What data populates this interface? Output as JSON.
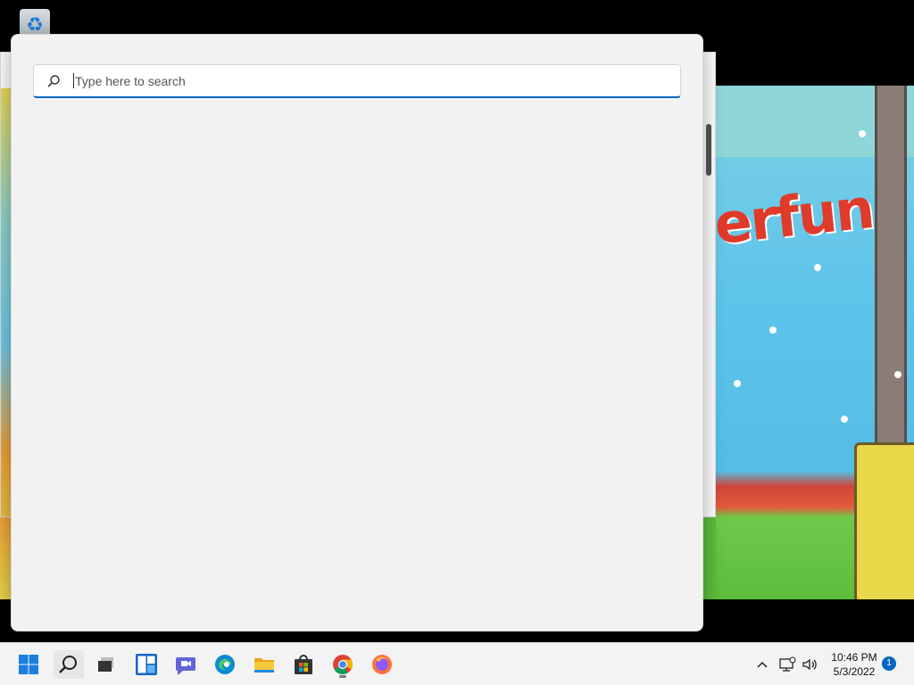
{
  "desktop": {
    "recycle_bin_icon": "recycle-bin-icon",
    "background_window_text": "erfun"
  },
  "search": {
    "placeholder": "Type here to search",
    "value": ""
  },
  "taskbar": {
    "items": [
      {
        "name": "Start",
        "icon": "windows-start-icon"
      },
      {
        "name": "Search",
        "icon": "search-icon"
      },
      {
        "name": "Task View",
        "icon": "task-view-icon"
      },
      {
        "name": "Widgets",
        "icon": "widgets-icon"
      },
      {
        "name": "Chat",
        "icon": "teams-chat-icon"
      },
      {
        "name": "Microsoft Edge",
        "icon": "edge-icon"
      },
      {
        "name": "File Explorer",
        "icon": "file-explorer-icon"
      },
      {
        "name": "Microsoft Store",
        "icon": "store-icon"
      },
      {
        "name": "Google Chrome",
        "icon": "chrome-icon"
      },
      {
        "name": "Firefox",
        "icon": "firefox-icon"
      }
    ],
    "clock": {
      "time": "10:46 PM",
      "date": "5/3/2022"
    },
    "notification_count": "1",
    "accent": "#0067c0"
  }
}
